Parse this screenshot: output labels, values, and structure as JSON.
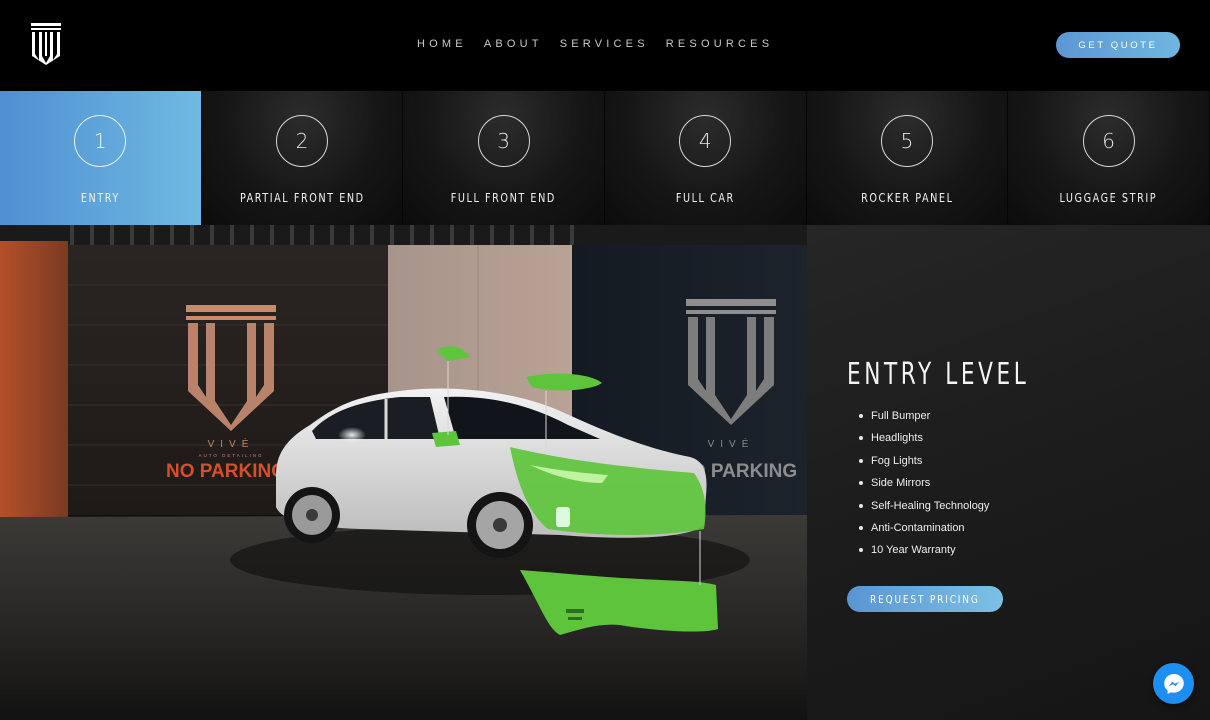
{
  "header": {
    "logo_icon": "vive-logo-icon",
    "nav": [
      {
        "label": "HOME"
      },
      {
        "label": "ABOUT"
      },
      {
        "label": "SERVICES"
      },
      {
        "label": "RESOURCES"
      }
    ],
    "quote_button": "GET QUOTE"
  },
  "steps": [
    {
      "number": "1",
      "label": "ENTRY",
      "active": true
    },
    {
      "number": "2",
      "label": "PARTIAL FRONT END",
      "active": false
    },
    {
      "number": "3",
      "label": "FULL FRONT END",
      "active": false
    },
    {
      "number": "4",
      "label": "FULL CAR",
      "active": false
    },
    {
      "number": "5",
      "label": "ROCKER PANEL",
      "active": false
    },
    {
      "number": "6",
      "label": "LUGGAGE STRIP",
      "active": false
    }
  ],
  "hero": {
    "wall_sign_left": {
      "brand": "VIVĖ",
      "sub": "AUTO DETAILING",
      "parking": "NO PARKING"
    },
    "wall_sign_right": {
      "brand": "VIVĖ",
      "parking": "O PARKING"
    }
  },
  "panel": {
    "title": "ENTRY LEVEL",
    "features": [
      "Full Bumper",
      "Headlights",
      "Fog Lights",
      "Side Mirrors",
      "Self-Healing Technology",
      "Anti-Contamination",
      "10 Year Warranty"
    ],
    "pricing_button": "REQUEST PRICING"
  },
  "colors": {
    "accent_blue": "#5d97d3",
    "accent_blue_light": "#6fbae2",
    "highlight_green": "#5ec43c",
    "messenger_blue": "#1d8ff2"
  },
  "messenger": {
    "icon": "messenger-icon"
  }
}
